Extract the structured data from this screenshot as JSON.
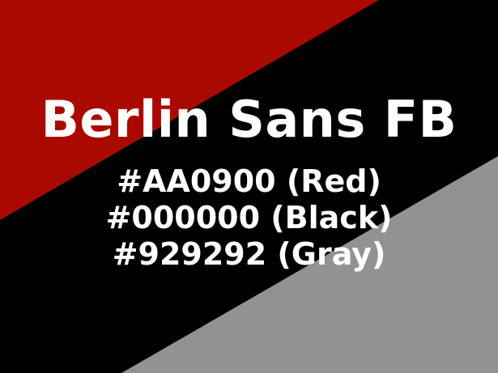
{
  "title": "Berlin Sans FB",
  "color_lines": [
    "#AA0900 (Red)",
    "#000000 (Black)",
    "#929292 (Gray)"
  ],
  "colors": {
    "red": "#AA0900",
    "black": "#000000",
    "gray": "#929292",
    "text": "#FFFFFF"
  }
}
